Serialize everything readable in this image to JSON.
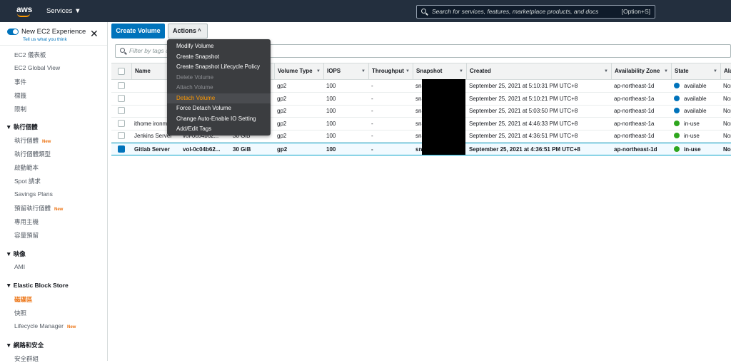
{
  "topbar": {
    "logo": "aws",
    "services_label": "Services ▼",
    "search_placeholder": "Search for services, features, marketplace products, and docs",
    "search_shortcut": "[Option+S]"
  },
  "sidebar": {
    "experience_title": "New EC2 Experience",
    "experience_sub": "Tell us what you think",
    "items_top": [
      "EC2 儀表板",
      "EC2 Global View",
      "事件",
      "標籤",
      "限制"
    ],
    "sections": [
      {
        "title": "▼  執行個體",
        "items": [
          {
            "label": "執行個體",
            "badge": "New"
          },
          {
            "label": "執行個體類型",
            "badge": ""
          },
          {
            "label": "啟動範本",
            "badge": ""
          },
          {
            "label": "Spot 請求",
            "badge": ""
          },
          {
            "label": "Savings Plans",
            "badge": ""
          },
          {
            "label": "預留執行個體",
            "badge": "New"
          },
          {
            "label": "專用主機",
            "badge": ""
          },
          {
            "label": "容量預留",
            "badge": ""
          }
        ]
      },
      {
        "title": "▼  映像",
        "items": [
          {
            "label": "AMI",
            "badge": ""
          }
        ]
      },
      {
        "title": "▼  Elastic Block Store",
        "items": [
          {
            "label": "磁碟區",
            "badge": "",
            "active": true
          },
          {
            "label": "快照",
            "badge": ""
          },
          {
            "label": "Lifecycle Manager",
            "badge": "New"
          }
        ]
      },
      {
        "title": "▼  網路和安全",
        "items": [
          {
            "label": "安全群組",
            "badge": ""
          }
        ]
      }
    ]
  },
  "toolbar": {
    "create_label": "Create Volume",
    "actions_label": "Actions",
    "actions_caret": "^",
    "filter_placeholder": "Filter by tags a"
  },
  "table": {
    "columns": [
      "Name",
      "Volume Type",
      "IOPS",
      "Throughput",
      "Snapshot",
      "Created",
      "Availability Zone",
      "State",
      "Ala"
    ],
    "rows": [
      {
        "name": "",
        "volume_id": "",
        "size": "",
        "type": "gp2",
        "iops": "100",
        "throughput": "-",
        "snapshot": "sna",
        "created": "September 25, 2021 at 5:10:31 PM UTC+8",
        "az": "ap-northeast-1d",
        "state": "available",
        "alarm": "Nor"
      },
      {
        "name": "",
        "volume_id": "",
        "size": "",
        "type": "gp2",
        "iops": "100",
        "throughput": "-",
        "snapshot": "sna",
        "created": "September 25, 2021 at 5:10:21 PM UTC+8",
        "az": "ap-northeast-1a",
        "state": "available",
        "alarm": "Nor"
      },
      {
        "name": "",
        "volume_id": "",
        "size": "",
        "type": "gp2",
        "iops": "100",
        "throughput": "-",
        "snapshot": "sna",
        "created": "September 25, 2021 at 5:03:50 PM UTC+8",
        "az": "ap-northeast-1d",
        "state": "available",
        "alarm": "Nor"
      },
      {
        "name": "ithome ironm",
        "volume_id": "",
        "size": "",
        "type": "gp2",
        "iops": "100",
        "throughput": "-",
        "snapshot": "sna",
        "created": "September 25, 2021 at 4:46:33 PM UTC+8",
        "az": "ap-northeast-1a",
        "state": "in-use",
        "alarm": "Nor"
      },
      {
        "name": "Jenkins Server",
        "volume_id": "vol-0c04b62...",
        "size": "30 GiB",
        "type": "gp2",
        "iops": "100",
        "throughput": "-",
        "snapshot": "sna",
        "created": "September 25, 2021 at 4:36:51 PM UTC+8",
        "az": "ap-northeast-1d",
        "state": "in-use",
        "alarm": "Nor"
      },
      {
        "name": "Gitlab Server",
        "volume_id": "vol-0c04b62...",
        "size": "30 GiB",
        "type": "gp2",
        "iops": "100",
        "throughput": "-",
        "snapshot": "sna",
        "created": "September 25, 2021 at 4:36:51 PM UTC+8",
        "az": "ap-northeast-1d",
        "state": "in-use",
        "alarm": "Nor"
      }
    ]
  },
  "actions_menu": [
    {
      "label": "Modify Volume",
      "state": "enabled"
    },
    {
      "label": "Create Snapshot",
      "state": "enabled"
    },
    {
      "label": "Create Snapshot Lifecycle Policy",
      "state": "enabled"
    },
    {
      "label": "Delete Volume",
      "state": "disabled"
    },
    {
      "label": "Attach Volume",
      "state": "disabled"
    },
    {
      "label": "Detach Volume",
      "state": "highlighted"
    },
    {
      "label": "Force Detach Volume",
      "state": "enabled"
    },
    {
      "label": "Change Auto-Enable IO Setting",
      "state": "enabled"
    },
    {
      "label": "Add/Edit Tags",
      "state": "enabled"
    }
  ],
  "colors": {
    "topbar": "#232f3e",
    "primary": "#0073bb",
    "accent_orange": "#ec7211",
    "available": "#0073bb",
    "in_use": "#1d8102"
  }
}
